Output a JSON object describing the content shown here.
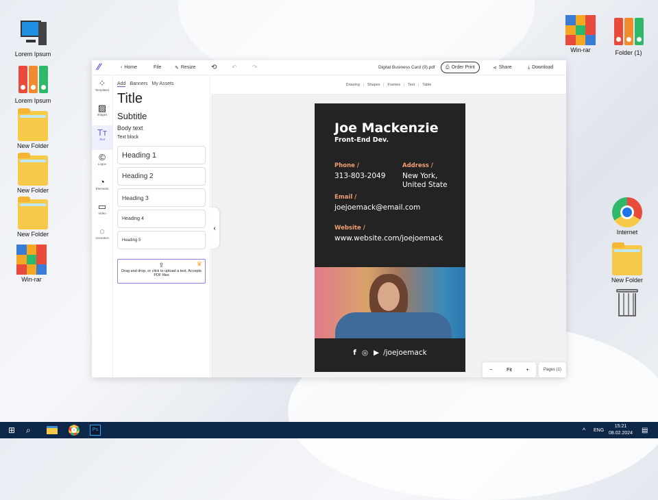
{
  "desktop": {
    "left": [
      {
        "label": "Lorem Ipsum",
        "icon": "computer-icon"
      },
      {
        "label": "Lorem Ipsum",
        "icon": "binders-icon"
      },
      {
        "label": "New Folder",
        "icon": "folder-icon"
      },
      {
        "label": "New Folder",
        "icon": "folder-icon"
      },
      {
        "label": "New Folder",
        "icon": "folder-icon"
      },
      {
        "label": "Win-rar",
        "icon": "winrar-icon"
      }
    ],
    "right": [
      {
        "label": "Win-rar"
      },
      {
        "label": "Folder (1)"
      },
      {
        "label": "Internet"
      },
      {
        "label": "New Folder"
      }
    ]
  },
  "topbar": {
    "home": "Home",
    "file": "File",
    "resize": "Resize",
    "filename": "Digital Business Card (9).pdf",
    "order": "Order Print",
    "share": "Share",
    "download": "Download"
  },
  "rail": [
    "Templates",
    "Images",
    "Text",
    "Logos",
    "Elements",
    "Video",
    "Animation"
  ],
  "panel": {
    "tabs": [
      "Add",
      "Banners",
      "My Assets"
    ],
    "title": "Title",
    "subtitle": "Subtitle",
    "body": "Body text",
    "block": "Text block",
    "headings": [
      "Heading 1",
      "Heading 2",
      "Heading 3",
      "Heading 4",
      "Heading 5"
    ],
    "upload": "Drag and drop, or click to upload a text. Accepts PDF files"
  },
  "canvas_tabs": [
    "Drawing",
    "Shapes",
    "Frames",
    "Text",
    "Table"
  ],
  "card": {
    "name": "Joe Mackenzie",
    "role": "Front-End Dev.",
    "phone_label": "Phone /",
    "phone": "313-803-2049",
    "address_label": "Address /",
    "address1": "New York,",
    "address2": "United State",
    "email_label": "Email /",
    "email": "joejoemack@email.com",
    "website_label": "Website /",
    "website": "www.website.com/joejoemack",
    "handle": "/joejoemack"
  },
  "zoom": {
    "minus": "−",
    "fit": "Fit",
    "plus": "+",
    "pages": "Pages (1)"
  },
  "taskbar": {
    "lang": "ENG",
    "time": "15:21",
    "date": "08.02.2024"
  },
  "colors": {
    "accent": "#6a5ae0",
    "card_bg": "#232323",
    "card_label": "#f0a070",
    "taskbar": "#0c2748"
  }
}
